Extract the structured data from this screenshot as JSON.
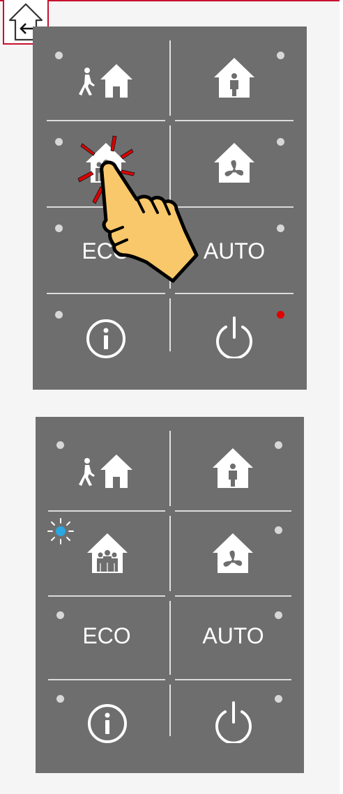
{
  "header": {
    "back_icon": "home-back-icon",
    "accent_color": "#c8102e"
  },
  "panels": [
    {
      "state": "press-gesture",
      "buttons": [
        {
          "id": "away",
          "icon": "person-leaving-home-icon",
          "led": "off"
        },
        {
          "id": "home",
          "icon": "person-in-home-icon",
          "led": "off"
        },
        {
          "id": "party",
          "icon": "group-in-home-icon",
          "led": "off"
        },
        {
          "id": "vent",
          "icon": "fan-home-icon",
          "led": "off"
        },
        {
          "id": "eco",
          "label": "ECO",
          "led": "off"
        },
        {
          "id": "auto",
          "label": "AUTO",
          "led": "off"
        },
        {
          "id": "info",
          "icon": "info-icon",
          "led": "off"
        },
        {
          "id": "power",
          "icon": "power-icon",
          "led": "red"
        }
      ],
      "gesture": {
        "icon": "pointing-hand-icon",
        "target": "party",
        "flash_color": "#e00000"
      }
    },
    {
      "state": "party-active",
      "buttons": [
        {
          "id": "away",
          "icon": "person-leaving-home-icon",
          "led": "off"
        },
        {
          "id": "home",
          "icon": "person-in-home-icon",
          "led": "off"
        },
        {
          "id": "party",
          "icon": "group-in-home-icon",
          "led": "blue-blinking"
        },
        {
          "id": "vent",
          "icon": "fan-home-icon",
          "led": "off"
        },
        {
          "id": "eco",
          "label": "ECO",
          "led": "off"
        },
        {
          "id": "auto",
          "label": "AUTO",
          "led": "off"
        },
        {
          "id": "info",
          "icon": "info-icon",
          "led": "off"
        },
        {
          "id": "power",
          "icon": "power-icon",
          "led": "off"
        }
      ]
    }
  ],
  "colors": {
    "panel": "#6e6e6e",
    "led_off": "#d7d7d7",
    "led_red": "#e00000",
    "led_blue": "#2aa7e0",
    "hand": "#f9c86a"
  }
}
